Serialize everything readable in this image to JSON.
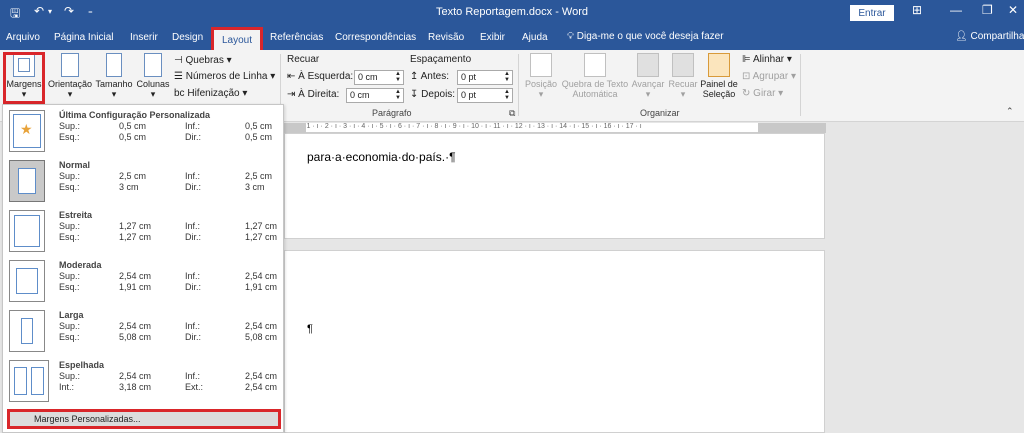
{
  "titlebar": {
    "title": "Texto Reportagem.docx - Word",
    "signin": "Entrar",
    "quick_access": [
      "save-icon",
      "undo-icon",
      "redo-icon",
      "customize-icon"
    ],
    "window_controls": [
      "ribbon-display-icon",
      "minimize-icon",
      "restore-icon",
      "close-icon"
    ]
  },
  "tabs": [
    "Arquivo",
    "Página Inicial",
    "Inserir",
    "Design",
    "Layout",
    "Referências",
    "Correspondências",
    "Revisão",
    "Exibir",
    "Ajuda"
  ],
  "tell_me": "Diga-me o que você deseja fazer",
  "share": "Compartilhar",
  "ribbon": {
    "margins": "Margens",
    "orientation": "Orientação",
    "size": "Tamanho",
    "columns": "Colunas",
    "breaks": "Quebras",
    "line_numbers": "Números de Linha",
    "hyphenation": "Hifenização",
    "indent_label": "Recuar",
    "left_label": "À Esquerda:",
    "left_value": "0 cm",
    "right_label": "À Direita:",
    "right_value": "0 cm",
    "spacing_label": "Espaçamento",
    "before_label": "Antes:",
    "before_value": "0 pt",
    "after_label": "Depois:",
    "after_value": "0 pt",
    "paragraph_group": "Parágrafo",
    "position": "Posição",
    "wrap_text_1": "Quebra de Texto",
    "wrap_text_2": "Automática",
    "bring_forward": "Avançar",
    "send_backward": "Recuar",
    "selection_pane_1": "Painel de",
    "selection_pane_2": "Seleção",
    "align": "Alinhar",
    "group": "Agrupar",
    "rotate": "Girar",
    "arrange_group": "Organizar"
  },
  "document": {
    "text": "para·a·economia·do·país.·¶",
    "pilcrow": "¶"
  },
  "ruler_text": "· 2 · ı · 1 · ı · 2 · ı · 3 · ı · 4 · ı · 5 · ı · 6 · ı · 7 · ı · 8 · ı · 9 · ı · 10 · ı · 11 · ı · 12 · ı · 13 · ı · 14 · ı · 15 · ı · 16 · ı · 17 · ı",
  "margin_options": [
    {
      "name": "Última Configuração Personalizada",
      "k1": "Sup.:",
      "v1": "0,5 cm",
      "k2": "Inf.:",
      "v2": "0,5 cm",
      "k3": "Esq.:",
      "v3": "0,5 cm",
      "k4": "Dir.:",
      "v4": "0,5 cm"
    },
    {
      "name": "Normal",
      "k1": "Sup.:",
      "v1": "2,5 cm",
      "k2": "Inf.:",
      "v2": "2,5 cm",
      "k3": "Esq.:",
      "v3": "3 cm",
      "k4": "Dir.:",
      "v4": "3 cm"
    },
    {
      "name": "Estreita",
      "k1": "Sup.:",
      "v1": "1,27 cm",
      "k2": "Inf.:",
      "v2": "1,27 cm",
      "k3": "Esq.:",
      "v3": "1,27 cm",
      "k4": "Dir.:",
      "v4": "1,27 cm"
    },
    {
      "name": "Moderada",
      "k1": "Sup.:",
      "v1": "2,54 cm",
      "k2": "Inf.:",
      "v2": "2,54 cm",
      "k3": "Esq.:",
      "v3": "1,91 cm",
      "k4": "Dir.:",
      "v4": "1,91 cm"
    },
    {
      "name": "Larga",
      "k1": "Sup.:",
      "v1": "2,54 cm",
      "k2": "Inf.:",
      "v2": "2,54 cm",
      "k3": "Esq.:",
      "v3": "5,08 cm",
      "k4": "Dir.:",
      "v4": "5,08 cm"
    },
    {
      "name": "Espelhada",
      "k1": "Sup.:",
      "v1": "2,54 cm",
      "k2": "Inf.:",
      "v2": "2,54 cm",
      "k3": "Int.:",
      "v3": "3,18 cm",
      "k4": "Ext.:",
      "v4": "2,54 cm"
    }
  ],
  "custom_margins": "Margens Personalizadas...",
  "colors": {
    "accent": "#2b579a",
    "highlight": "#d9262a"
  }
}
